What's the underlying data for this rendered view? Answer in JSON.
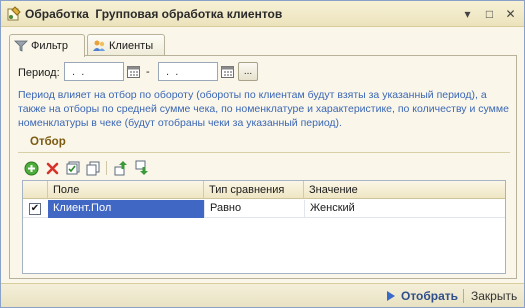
{
  "window": {
    "title": "Обработка  Групповая обработка клиентов",
    "menu_glyph": "▾",
    "maximize_glyph": "□",
    "close_glyph": "✕"
  },
  "tabs": [
    {
      "label": "Фильтр",
      "icon": "funnel-icon",
      "active": true
    },
    {
      "label": "Клиенты",
      "icon": "users-icon",
      "active": false
    }
  ],
  "period": {
    "label": "Период:",
    "start_value": " .  .",
    "end_value": " .  .",
    "dash": "-",
    "choose_label": "..."
  },
  "note": "Период влияет на отбор по обороту (обороты по клиентам будут взяты за указанный период), а также на отборы по средней сумме чека, по номенклатуре и характеристике, по количеству и сумме номенклатуры в чеке (будут отобраны чеки за указанный период).",
  "filter": {
    "title": "Отбор",
    "toolbar": [
      "add-icon",
      "delete-icon",
      "check-all-icon",
      "copy-icon",
      "move-up-icon",
      "move-down-icon"
    ],
    "columns": {
      "field": "Поле",
      "comparison": "Тип сравнения",
      "value": "Значение"
    },
    "rows": [
      {
        "checked": true,
        "check_glyph": "✔",
        "field": "Клиент.Пол",
        "comparison": "Равно",
        "value": "Женский"
      }
    ]
  },
  "footer": {
    "select_label": "Отобрать",
    "close_label": "Закрыть"
  },
  "colors": {
    "accent": "#3f67c3",
    "note_text": "#3b66b5",
    "section_title": "#7a5a10",
    "background": "#faf7ea"
  }
}
